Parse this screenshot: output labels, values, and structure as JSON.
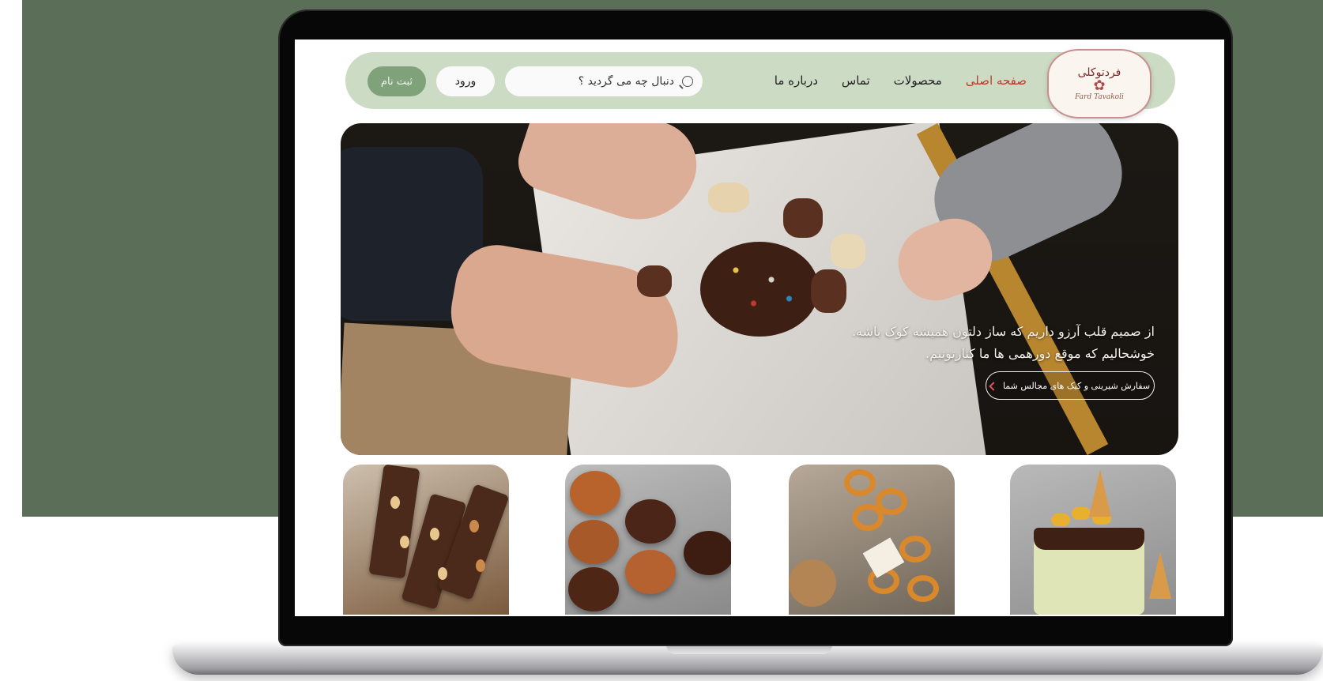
{
  "brand": {
    "logo_title": "فردتوکلی",
    "logo_subtitle": "Fard Tavakoli"
  },
  "nav": {
    "links": [
      {
        "label": "صفحه اصلی",
        "active": true
      },
      {
        "label": "محصولات",
        "active": false
      },
      {
        "label": "تماس",
        "active": false
      },
      {
        "label": "درباره ما",
        "active": false
      }
    ]
  },
  "search": {
    "placeholder": "دنبال چه می گردید ؟"
  },
  "auth": {
    "login_label": "ورود",
    "signup_label": "ثبت نام"
  },
  "hero": {
    "line1": "از صمیم قلب آرزو داریم که ساز دلتون همیشه کوک باشه.",
    "line2": "خوشحالیم که موقع دورهمی ها ما کنارتونیم.",
    "cta_label": "سفارش شیرینی و کیک های مجالس شما"
  },
  "products": [
    {
      "name": "chocolate-bars-card",
      "icon": "chocolate-with-nuts"
    },
    {
      "name": "chocolate-cookies-card",
      "icon": "choco-pies"
    },
    {
      "name": "pretzel-platter-card",
      "icon": "pretzel-platter"
    },
    {
      "name": "drip-cake-card",
      "icon": "drip-cake"
    }
  ],
  "colors": {
    "page_green": "#5a6e58",
    "nav_bg": "#ccdcc4",
    "signup_bg": "#7fa27b",
    "active_link": "#c0392b"
  }
}
